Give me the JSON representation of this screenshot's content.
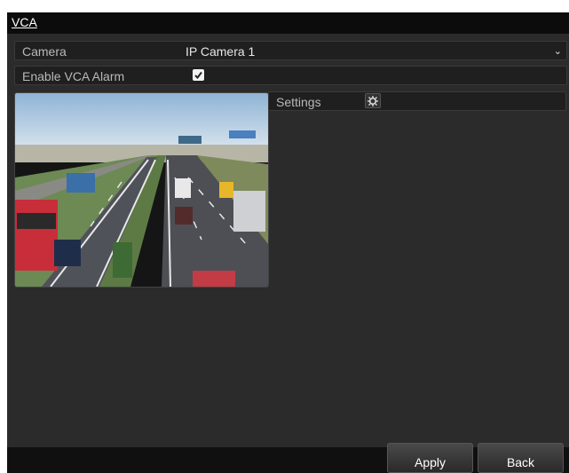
{
  "window": {
    "title": "VCA"
  },
  "camera": {
    "label": "Camera",
    "value": "IP Camera 1"
  },
  "enable_vca_alarm": {
    "label": "Enable VCA Alarm",
    "checked": true
  },
  "settings": {
    "label": "Settings",
    "icon": "gear-icon"
  },
  "buttons": {
    "apply": "Apply",
    "back": "Back"
  },
  "colors": {
    "background": "#2b2b2b",
    "titlebar": "#0c0c0c",
    "row": "#1f1f1f",
    "text": "#b9b9b9"
  }
}
